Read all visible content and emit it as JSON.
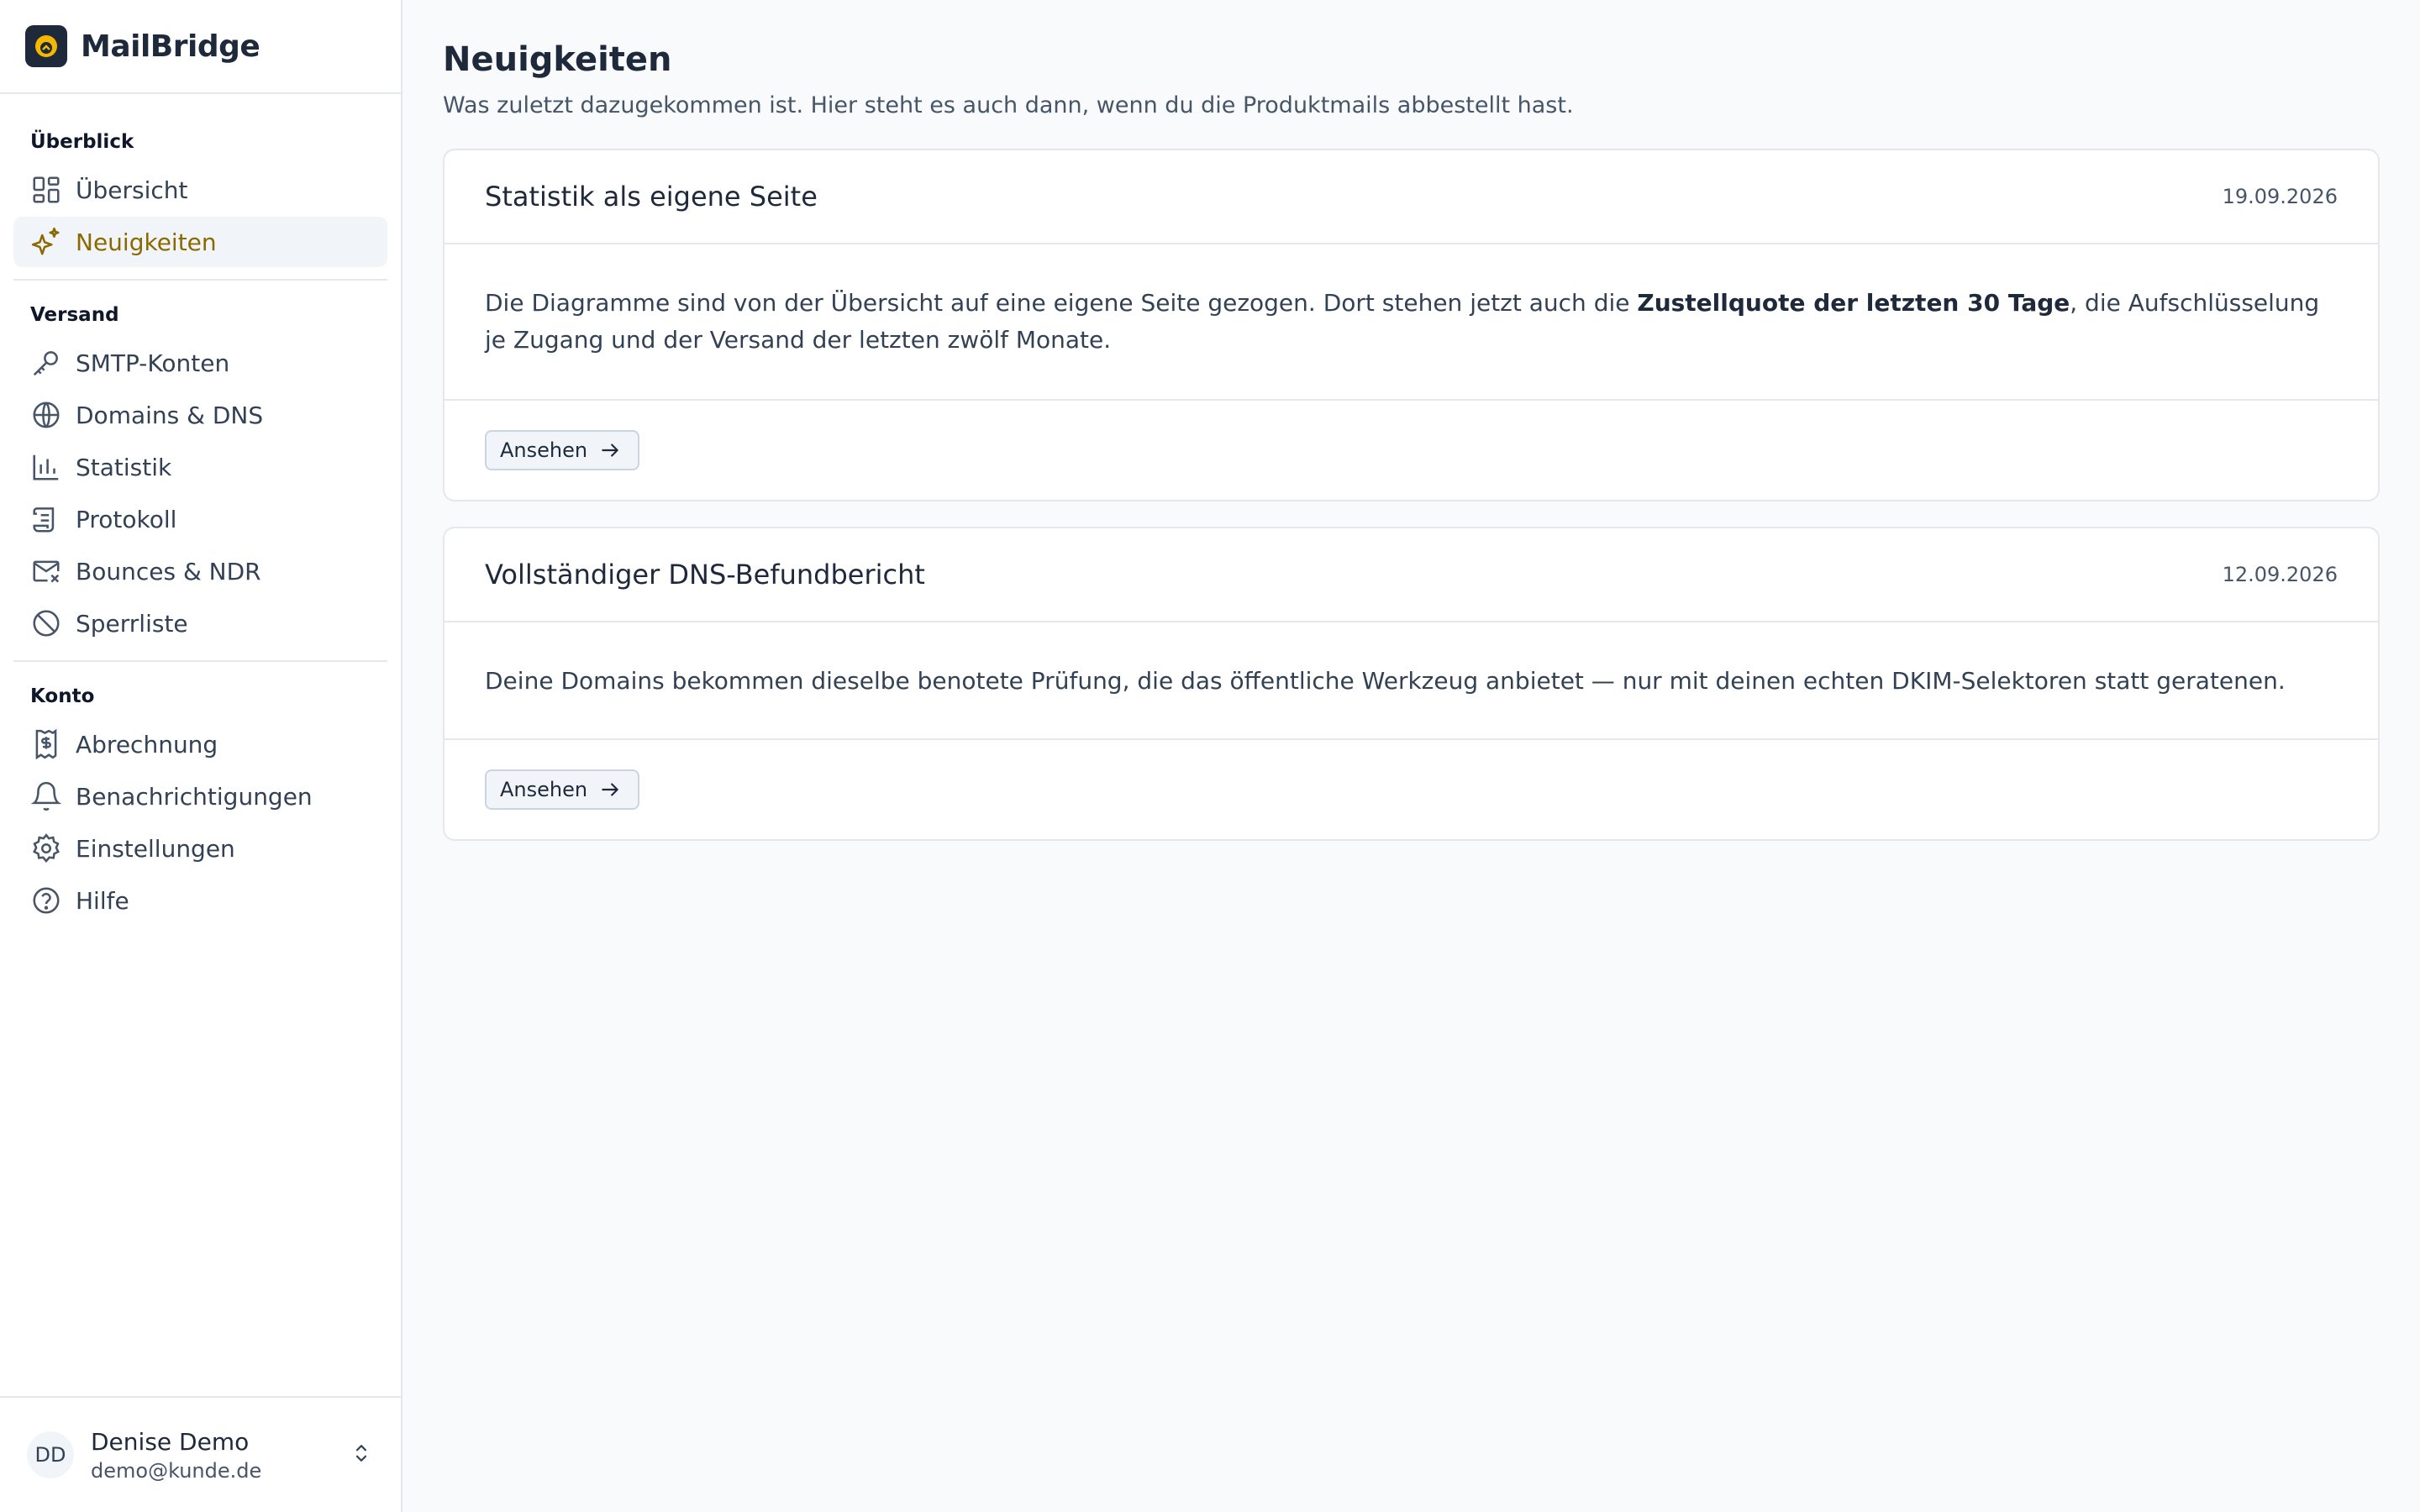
{
  "brand": {
    "name": "MailBridge"
  },
  "sidebar": {
    "sections": [
      {
        "title": "Überblick",
        "items": [
          {
            "label": "Übersicht",
            "icon": "dashboard-icon"
          },
          {
            "label": "Neuigkeiten",
            "icon": "sparkles-icon",
            "active": true
          }
        ]
      },
      {
        "title": "Versand",
        "items": [
          {
            "label": "SMTP-Konten",
            "icon": "key-icon"
          },
          {
            "label": "Domains & DNS",
            "icon": "globe-icon"
          },
          {
            "label": "Statistik",
            "icon": "bar-chart-icon"
          },
          {
            "label": "Protokoll",
            "icon": "scroll-icon"
          },
          {
            "label": "Bounces & NDR",
            "icon": "mail-x-icon"
          },
          {
            "label": "Sperrliste",
            "icon": "ban-icon"
          }
        ]
      },
      {
        "title": "Konto",
        "items": [
          {
            "label": "Abrechnung",
            "icon": "receipt-icon"
          },
          {
            "label": "Benachrichtigungen",
            "icon": "bell-icon"
          },
          {
            "label": "Einstellungen",
            "icon": "gear-icon"
          },
          {
            "label": "Hilfe",
            "icon": "help-icon"
          }
        ]
      }
    ]
  },
  "user": {
    "initials": "DD",
    "name": "Denise Demo",
    "email": "demo@kunde.de"
  },
  "main": {
    "title": "Neuigkeiten",
    "subtitle": "Was zuletzt dazugekommen ist. Hier steht es auch dann, wenn du die Produktmails abbestellt hast.",
    "cards": [
      {
        "title": "Statistik als eigene Seite",
        "date": "19.09.2026",
        "body_pre": "Die Diagramme sind von der Übersicht auf eine eigene Seite gezogen. Dort stehen jetzt auch die ",
        "body_bold": "Zustellquote der letzten 30 Tage",
        "body_post": ", die Aufschlüsselung je Zugang und der Versand der letzten zwölf Monate.",
        "button": "Ansehen"
      },
      {
        "title": "Vollständiger DNS-Befundbericht",
        "date": "12.09.2026",
        "body": "Deine Domains bekommen dieselbe benotete Prüfung, die das öffentliche Werkzeug anbietet — nur mit deinen echten DKIM-Selektoren statt geratenen.",
        "button": "Ansehen"
      }
    ]
  },
  "colors": {
    "accent": "#8a6a00",
    "logo_bg": "#1e293b",
    "logo_mark": "#f5b800"
  }
}
